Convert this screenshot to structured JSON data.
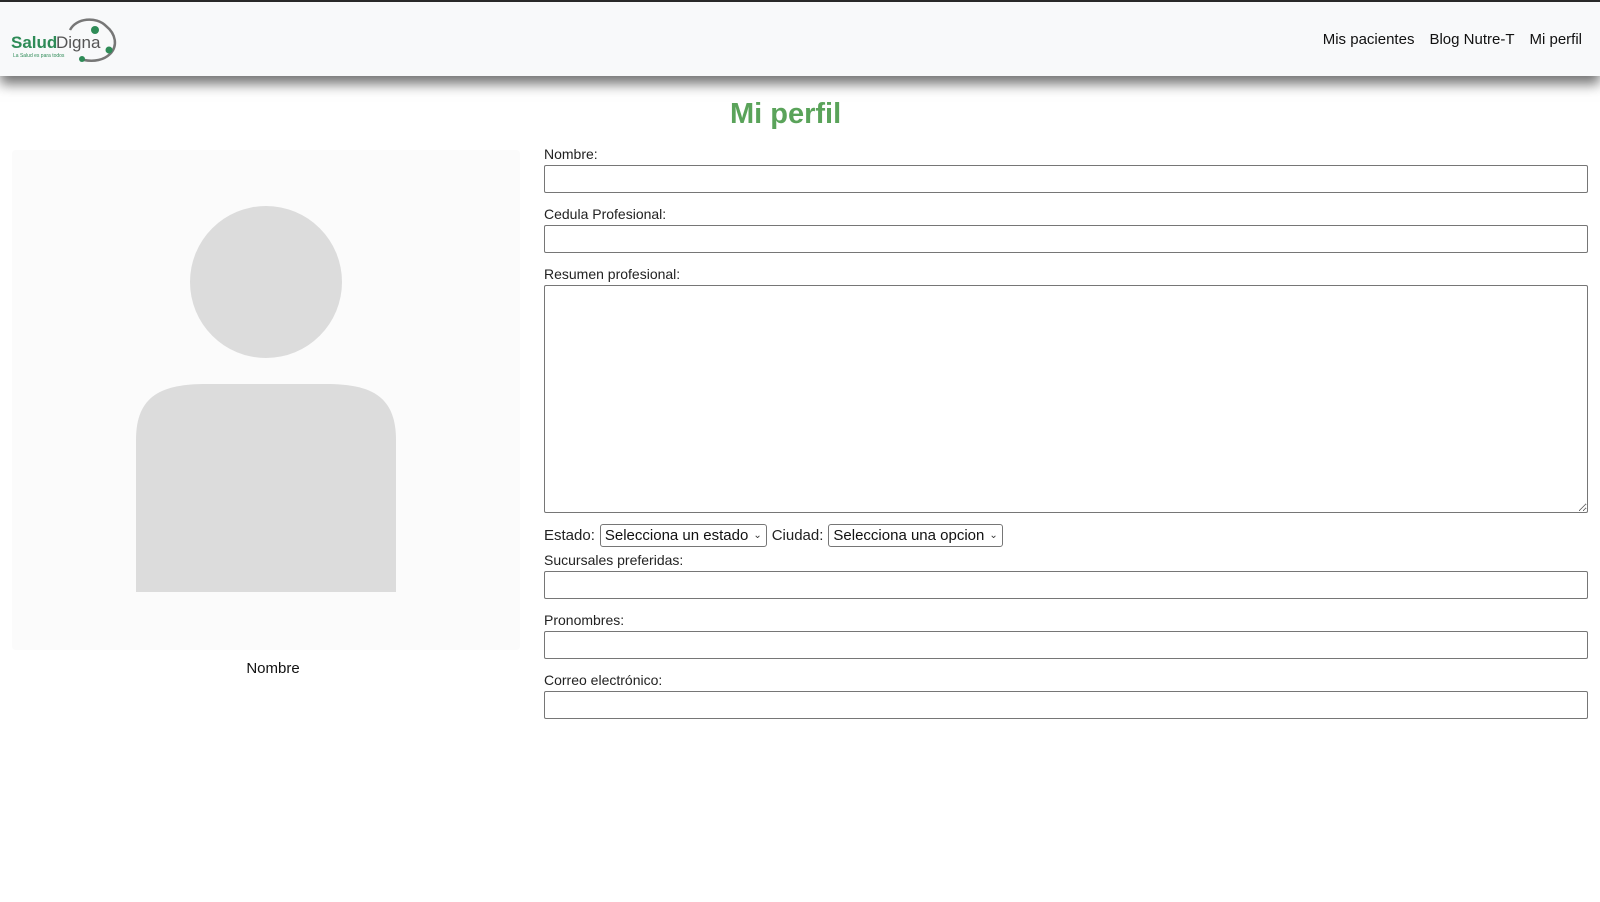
{
  "brand": {
    "name_part1": "Salud",
    "name_part2": "Digna",
    "tagline": "La Salud es para todos",
    "color_green": "#2e8b57",
    "color_gray": "#555555"
  },
  "nav": {
    "items": [
      {
        "label": "Mis pacientes"
      },
      {
        "label": "Blog Nutre-T"
      },
      {
        "label": "Mi perfil"
      }
    ]
  },
  "page": {
    "title": "Mi perfil",
    "title_color": "#5aa35a"
  },
  "profile_card": {
    "name": "Nombre",
    "avatar_icon": "user-silhouette-icon"
  },
  "form": {
    "nombre_label": "Nombre:",
    "nombre_value": "",
    "cedula_label": "Cedula Profesional:",
    "cedula_value": "",
    "resumen_label": "Resumen profesional:",
    "resumen_value": "",
    "estado_label": "Estado:",
    "estado_selected": "Selecciona un estado",
    "ciudad_label": "Ciudad:",
    "ciudad_selected": "Selecciona una opcion",
    "sucursales_label": "Sucursales preferidas:",
    "sucursales_value": "",
    "pronombres_label": "Pronombres:",
    "pronombres_value": "",
    "correo_label": "Correo electrónico:",
    "correo_value": ""
  }
}
